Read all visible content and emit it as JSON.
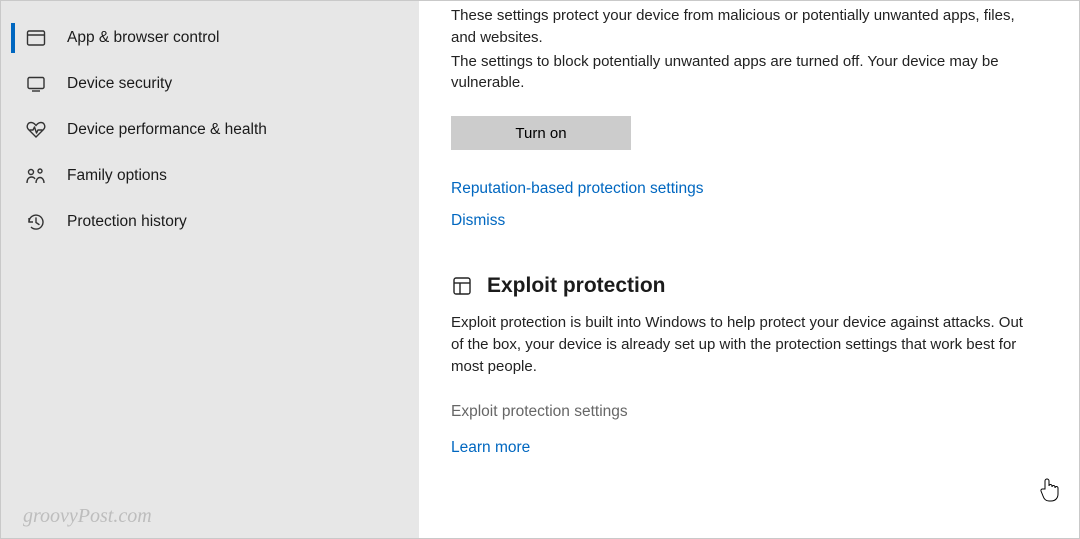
{
  "sidebar": {
    "items": [
      {
        "label": "App & browser control",
        "icon": "app-browser-icon",
        "selected": true
      },
      {
        "label": "Device security",
        "icon": "device-security-icon",
        "selected": false
      },
      {
        "label": "Device performance & health",
        "icon": "health-icon",
        "selected": false
      },
      {
        "label": "Family options",
        "icon": "family-icon",
        "selected": false
      },
      {
        "label": "Protection history",
        "icon": "history-icon",
        "selected": false
      }
    ]
  },
  "reputation": {
    "desc_line1": "These settings protect your device from malicious or potentially unwanted apps, files, and websites.",
    "desc_line2": "The settings to block potentially unwanted apps are turned off. Your device may be vulnerable.",
    "turn_on_label": "Turn on",
    "settings_link": "Reputation-based protection settings",
    "dismiss_link": "Dismiss"
  },
  "exploit": {
    "heading": "Exploit protection",
    "desc": "Exploit protection is built into Windows to help protect your device against attacks.  Out of the box, your device is already set up with the protection settings that work best for most people.",
    "settings_label": "Exploit protection settings",
    "learn_more": "Learn more"
  },
  "watermark": "groovyPost.com"
}
